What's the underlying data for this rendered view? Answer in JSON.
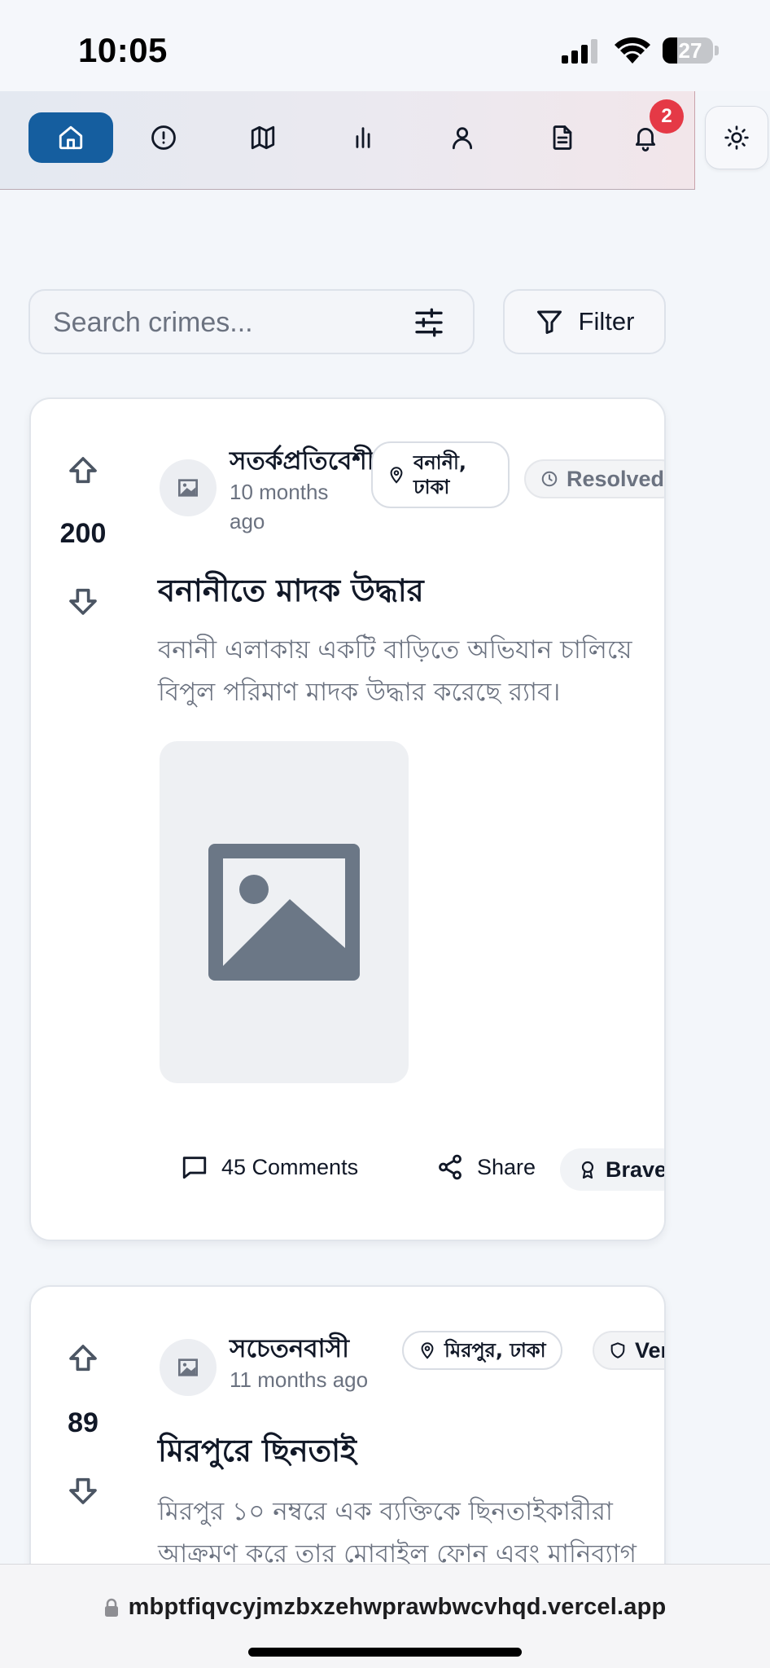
{
  "status_bar": {
    "time": "10:05",
    "battery": "27",
    "icons": [
      "signal-icon",
      "wifi-icon",
      "battery-icon"
    ]
  },
  "nav": {
    "items": [
      {
        "name": "home",
        "icon": "home-icon",
        "active": true
      },
      {
        "name": "alerts",
        "icon": "alert-circle-icon",
        "active": false
      },
      {
        "name": "map",
        "icon": "map-icon",
        "active": false
      },
      {
        "name": "stats",
        "icon": "bar-chart-icon",
        "active": false
      },
      {
        "name": "profile",
        "icon": "user-icon",
        "active": false
      },
      {
        "name": "reports",
        "icon": "document-icon",
        "active": false
      },
      {
        "name": "notifications",
        "icon": "bell-icon",
        "active": false
      }
    ],
    "notification_count": "2",
    "theme_icon": "sun-icon",
    "accent_color": "#155e9f",
    "badge_color": "#e53946"
  },
  "search": {
    "placeholder": "Search crimes...",
    "value": "",
    "filter_label": "Filter"
  },
  "posts": [
    {
      "votes": "200",
      "user": "সতর্কপ্রতিবেশী",
      "time_ago": "10 months ago",
      "location": "বনানী, ঢাকা",
      "status": "Resolved",
      "title": "বনানীতে মাদক উদ্ধার",
      "description_lines": [
        "বনানী এলাকায় একটি বাড়িতে অভিযান চালিয়ে",
        "বিপুল পরিমাণ মাদক উদ্ধার করেছে র‍্যাব।"
      ],
      "comments": "45 Comments",
      "share": "Share",
      "badge": "Brave"
    },
    {
      "votes": "89",
      "user": "সচেতনবাসী",
      "time_ago": "11 months ago",
      "location": "মিরপুর, ঢাকা",
      "status": "Verified",
      "title": "মিরপুরে ছিনতাই",
      "description_lines": [
        "মিরপুর ১০ নম্বরে এক ব্যক্তিকে ছিনতাইকারীরা",
        "আক্রমণ করে তার মোবাইল ফোন এবং মানিব্যাগ"
      ]
    }
  ],
  "url_bar": {
    "url": "mbptfiqvcyjmzbxzehwprawbwcvhqd.vercel.app"
  }
}
